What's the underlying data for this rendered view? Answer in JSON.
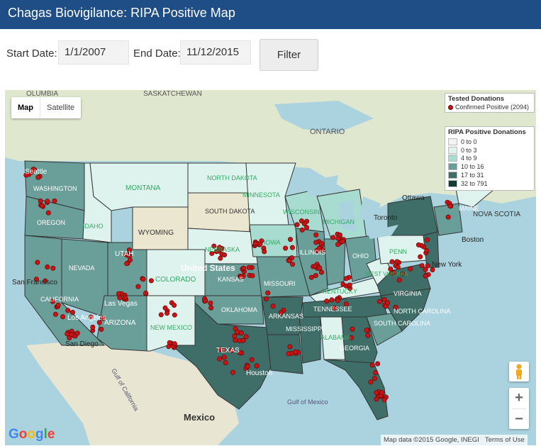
{
  "header": {
    "title": "Chagas Biovigilance: RIPA Positive Map"
  },
  "filters": {
    "start_label": "Start Date:",
    "start_value": "1/1/2007",
    "end_label": "End Date:",
    "end_value": "11/12/2015",
    "filter_button": "Filter"
  },
  "map": {
    "type_control": {
      "map": "Map",
      "satellite": "Satellite"
    },
    "labels": {
      "states": [
        "WASHINGTON",
        "OREGON",
        "IDAHO",
        "MONTANA",
        "WYOMING",
        "NEVADA",
        "UTAH",
        "COLORADO",
        "ARIZONA",
        "NEW MEXICO",
        "NORTH DAKOTA",
        "SOUTH DAKOTA",
        "NEBRASKA",
        "KANSAS",
        "OKLAHOMA",
        "TEXAS",
        "MINNESOTA",
        "IOWA",
        "MISSOURI",
        "ARKANSAS",
        "WISCONSIN",
        "ILLINOIS",
        "MICHIGAN",
        "OHIO",
        "KENTUCKY",
        "TENNESSEE",
        "MISSISSIPPI",
        "ALABAMA",
        "GEORGIA",
        "SOUTH CAROLINA",
        "NORTH CAROLINA",
        "VIRGINIA",
        "WEST VIRGINIA",
        "PENN",
        "MAINE",
        "CALIFORNIA"
      ],
      "places": [
        "Seattle",
        "San Francisco",
        "Los Angeles",
        "San Diego",
        "Las Vegas",
        "Houston",
        "Toronto",
        "Ottawa",
        "Boston",
        "New York",
        "United States",
        "Mexico",
        "Gulf of Mexico",
        "Gulf of California",
        "ONTARIO",
        "SASKATCHEWAN",
        "OLUMBIA",
        "NOVA SCOTIA"
      ]
    },
    "attribution": "Map data ©2015 Google, INEGI",
    "terms": "Terms of Use",
    "google_logo": "Google"
  },
  "legend_tested": {
    "title": "Tested Donations",
    "item": "Confirmed Positive (2094)",
    "dot_color": "#c81414"
  },
  "legend_ripa": {
    "title": "RIPA Positive Donations",
    "bins": [
      {
        "label": "0 to 0",
        "color": "#f2f2ee"
      },
      {
        "label": "0 to 3",
        "color": "#dff3ee"
      },
      {
        "label": "4 to 9",
        "color": "#a8dcd1"
      },
      {
        "label": "10 to 16",
        "color": "#6a9e98"
      },
      {
        "label": "17 to 31",
        "color": "#3f6e68"
      },
      {
        "label": "32 to 791",
        "color": "#123c38"
      }
    ]
  },
  "colors": {
    "header_bg": "#1f4e86",
    "water": "#abd3df"
  }
}
